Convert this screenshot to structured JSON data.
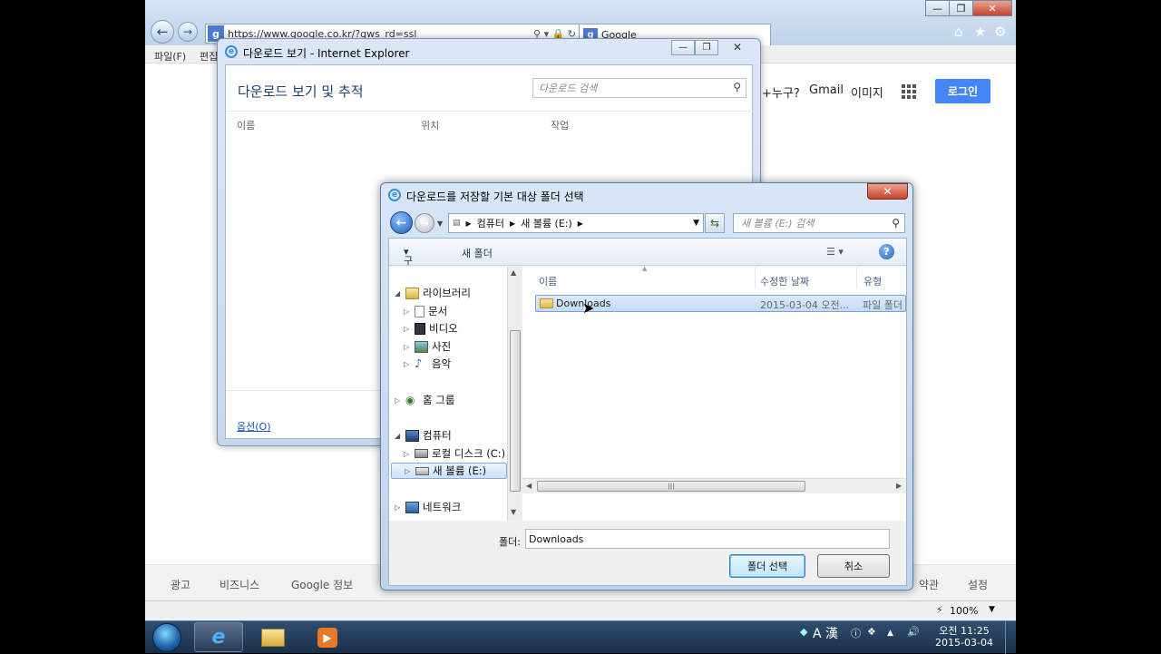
{
  "ie": {
    "back_icon": "back-arrow-icon",
    "forward_icon": "forward-arrow-icon",
    "url": "https://www.google.co.kr/?gws_rd=ssl",
    "tab_title": "Google",
    "menu": [
      "파일(F)",
      "편집"
    ],
    "zoom": "100%"
  },
  "google": {
    "links": [
      "+누구?",
      "Gmail",
      "이미지"
    ],
    "login": "로그인",
    "footer_left": [
      "광고",
      "비즈니스",
      "Google 정보"
    ],
    "footer_right": [
      "약관",
      "설정"
    ]
  },
  "download_window": {
    "title": "다운로드 보기 - Internet Explorer",
    "heading": "다운로드 보기 및 추적",
    "search_placeholder": "다운로드 검색",
    "columns": [
      "이름",
      "위치",
      "작업"
    ],
    "option_link": "옵션(O)"
  },
  "folder_dialog": {
    "title": "다운로드를 저장할 기본 대상 폴더 선택",
    "breadcrumb": [
      "컴퓨터",
      "새 볼륨 (E:)"
    ],
    "search_placeholder": "새 볼륨 (E:) 검색",
    "toolbar": {
      "organize": "구성",
      "new_folder": "새 폴더"
    },
    "tree": [
      {
        "label": "라이브러리",
        "level": 0,
        "expanded": true,
        "icon": "library-icon"
      },
      {
        "label": "문서",
        "level": 1,
        "icon": "document-icon"
      },
      {
        "label": "비디오",
        "level": 1,
        "icon": "video-icon"
      },
      {
        "label": "사진",
        "level": 1,
        "icon": "picture-icon"
      },
      {
        "label": "음악",
        "level": 1,
        "icon": "music-icon"
      },
      {
        "label": "홈 그룹",
        "level": 0,
        "icon": "homegroup-icon"
      },
      {
        "label": "컴퓨터",
        "level": 0,
        "expanded": true,
        "icon": "computer-icon"
      },
      {
        "label": "로컬 디스크 (C:)",
        "level": 1,
        "icon": "disk-icon"
      },
      {
        "label": "새 볼륨 (E:)",
        "level": 1,
        "selected": true,
        "icon": "drive-icon"
      },
      {
        "label": "네트워크",
        "level": 0,
        "icon": "network-icon"
      }
    ],
    "list_columns": [
      "이름",
      "수정한 날짜",
      "유형"
    ],
    "files": [
      {
        "name": "Downloads",
        "modified": "2015-03-04 오전...",
        "type": "파일 폴더"
      }
    ],
    "folder_label": "폴더:",
    "folder_value": "Downloads",
    "select_button": "폴더 선택",
    "cancel_button": "취소"
  },
  "taskbar": {
    "ime": "A 漢",
    "time": "오전 11:25",
    "date": "2015-03-04"
  },
  "colors": {
    "accent": "#4285f4",
    "selection": "#cde3fb",
    "taskbar": "#1b2f47"
  }
}
